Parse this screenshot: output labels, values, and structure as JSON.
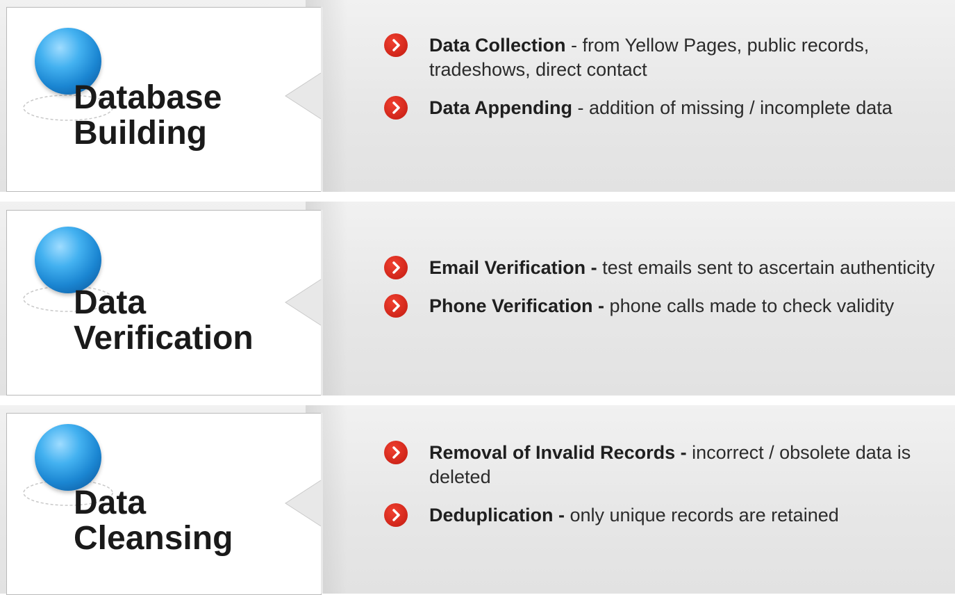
{
  "sections": [
    {
      "title": [
        "Database",
        "Building"
      ],
      "bullets": [
        {
          "bold": "Data Collection",
          "text": " - from Yellow Pages, public records, tradeshows, direct contact"
        },
        {
          "bold": "Data Appending",
          "text": " - addition of missing / incomplete data"
        }
      ]
    },
    {
      "title": [
        "Data",
        "Verification"
      ],
      "bullets": [
        {
          "bold": "Email Verification -",
          "text": " test emails sent to ascertain authenticity"
        },
        {
          "bold": "Phone Verification -",
          "text": " phone calls made to check validity"
        }
      ]
    },
    {
      "title": [
        "Data",
        "Cleansing"
      ],
      "bullets": [
        {
          "bold": "Removal of Invalid Records -",
          "text": " incorrect / obsolete data is deleted"
        },
        {
          "bold": "Deduplication -",
          "text": " only unique records are retained"
        }
      ]
    }
  ],
  "icons": {
    "sphere": "blue-sphere-icon",
    "bullet": "red-chevron-icon"
  },
  "colors": {
    "sphere": "#1b86d2",
    "bullet": "#d42a1c",
    "band": "#e6e6e6"
  }
}
